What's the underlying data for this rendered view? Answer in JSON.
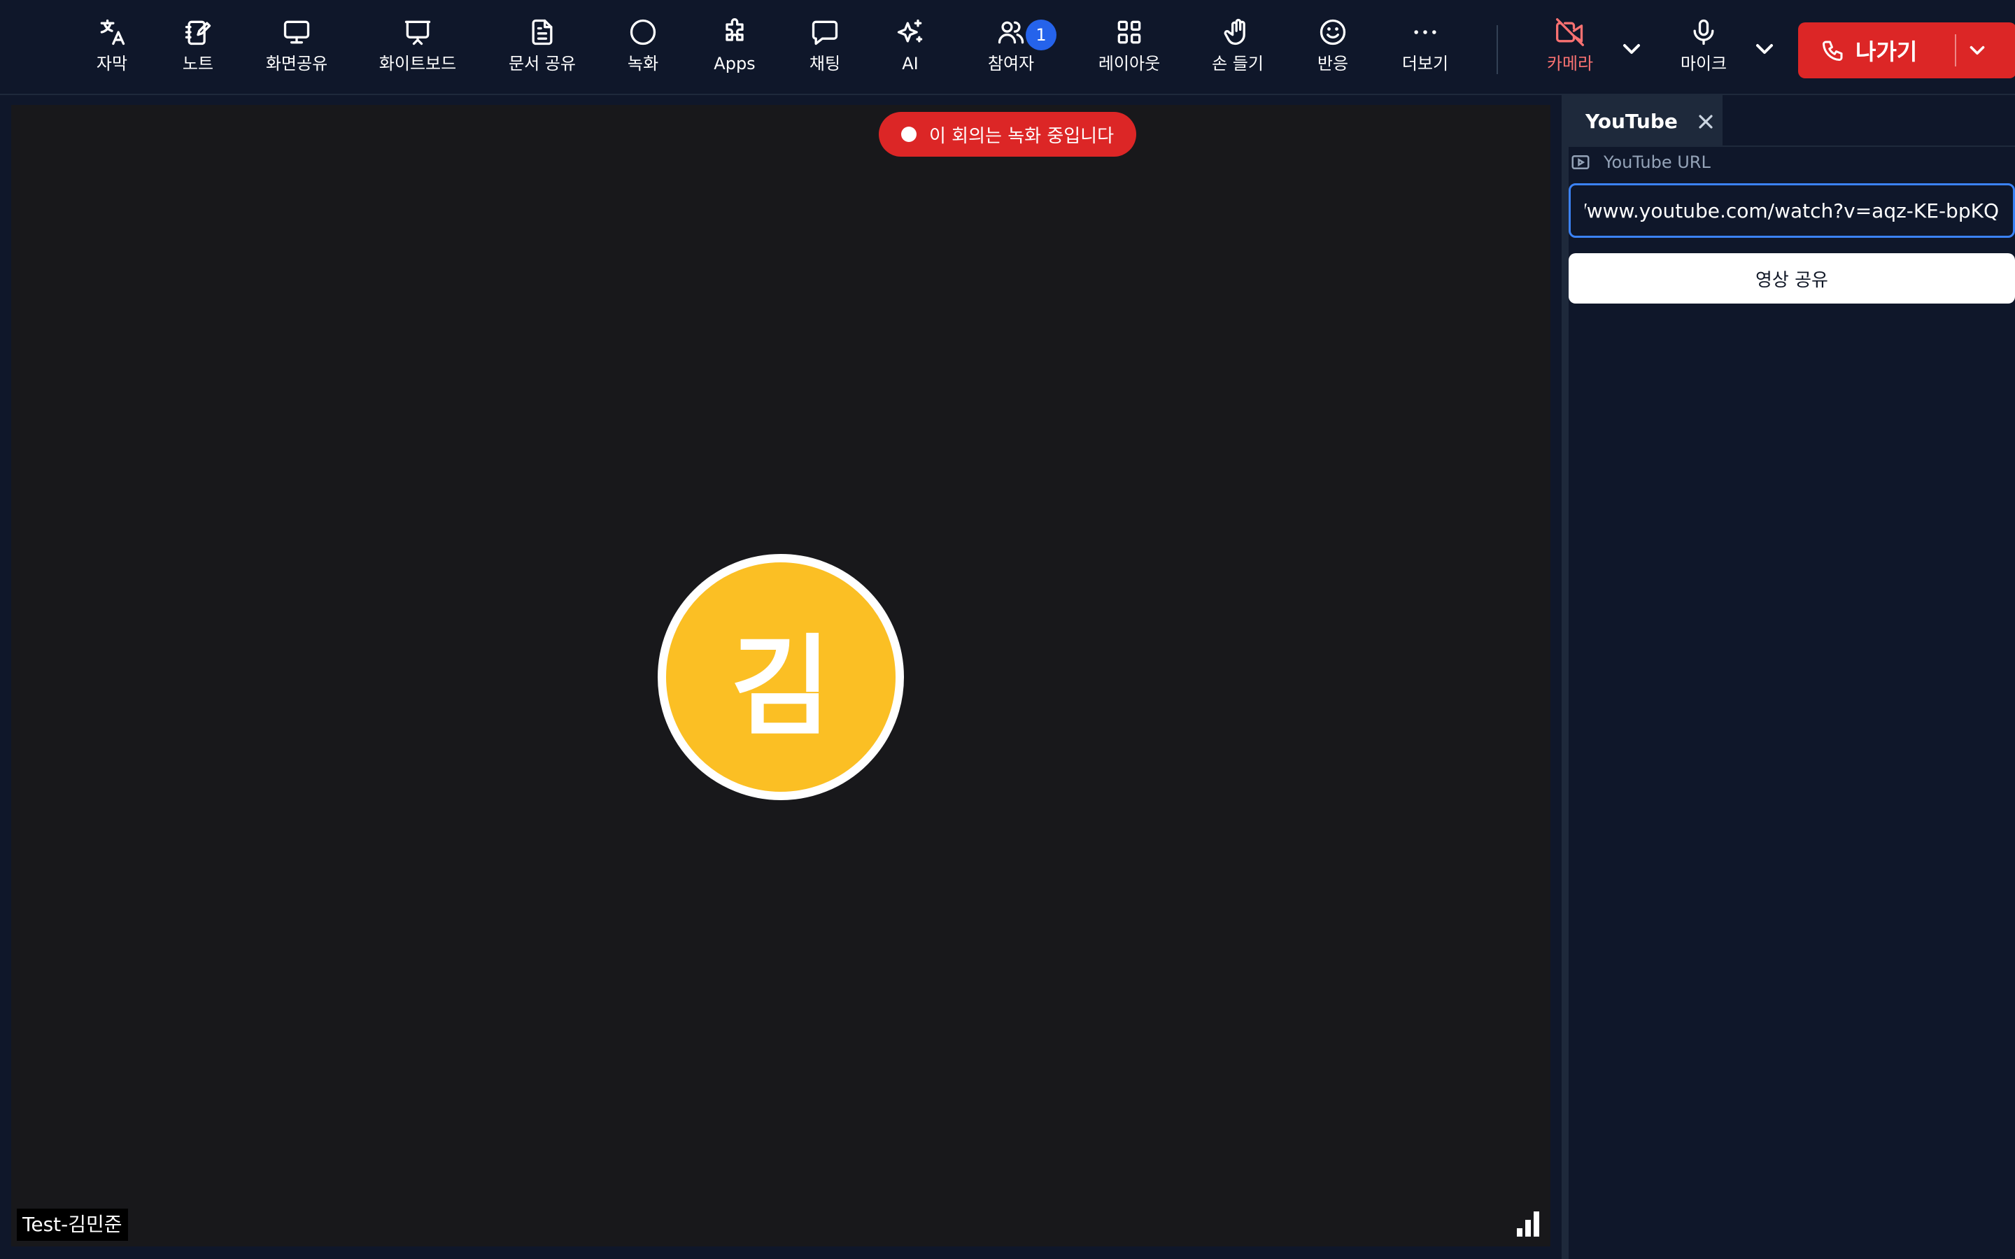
{
  "toolbar": {
    "items": [
      {
        "label": "자막",
        "icon": "translate-icon"
      },
      {
        "label": "노트",
        "icon": "note-icon"
      },
      {
        "label": "화면공유",
        "icon": "monitor-icon"
      },
      {
        "label": "화이트보드",
        "icon": "whiteboard-icon"
      },
      {
        "label": "문서 공유",
        "icon": "document-icon"
      },
      {
        "label": "녹화",
        "icon": "record-icon"
      },
      {
        "label": "Apps",
        "icon": "puzzle-icon"
      },
      {
        "label": "채팅",
        "icon": "chat-icon"
      },
      {
        "label": "AI",
        "icon": "sparkles-icon"
      },
      {
        "label": "참여자",
        "icon": "users-icon",
        "badge": "1"
      },
      {
        "label": "레이아웃",
        "icon": "grid-icon"
      },
      {
        "label": "손 들기",
        "icon": "hand-icon"
      },
      {
        "label": "반응",
        "icon": "smiley-icon"
      },
      {
        "label": "더보기",
        "icon": "more-icon"
      }
    ],
    "camera": {
      "label": "카메라",
      "icon": "camera-off-icon",
      "color": "#f87171"
    },
    "mic": {
      "label": "마이크",
      "icon": "mic-icon"
    },
    "leave": {
      "label": "나가기",
      "icon": "phone-icon",
      "color": "#dc2626"
    }
  },
  "stage": {
    "recording_banner": "이 회의는 녹화 중입니다",
    "avatar_initial": "김",
    "avatar_color": "#fbbf24",
    "participant_name": "Test-김민준"
  },
  "panel": {
    "tab_label": "YouTube",
    "url_label": "YouTube URL",
    "url_value": "https://www.youtube.com/watch?v=aqz-KE-bpKQ",
    "share_button": "영상 공유",
    "accent": "#3b82f6"
  }
}
